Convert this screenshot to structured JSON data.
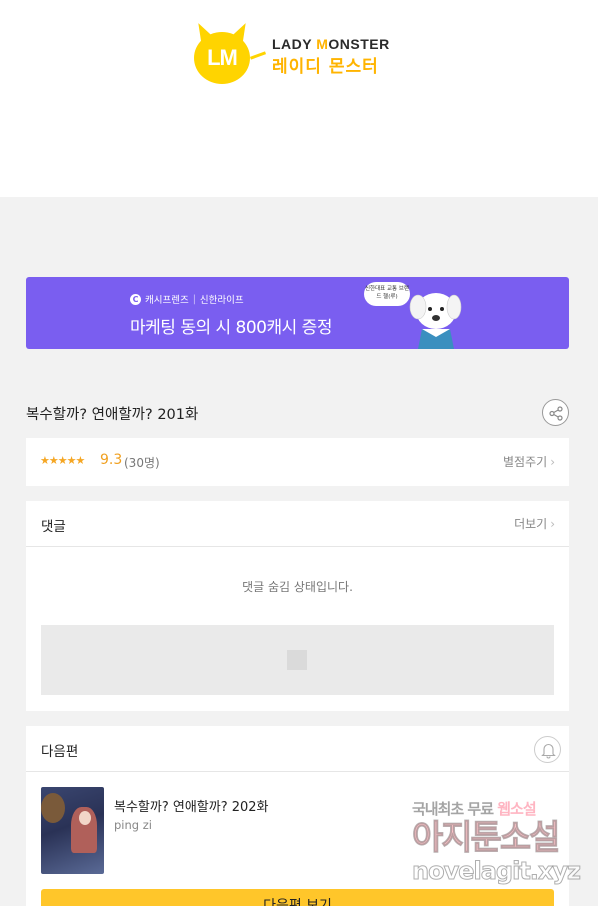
{
  "header": {
    "logo_mark": "LM",
    "logo_en_prefix": "LADY ",
    "logo_en_o": "M",
    "logo_en_rest": "ONSTER",
    "logo_ko": "레이디 몬스터"
  },
  "banner": {
    "c_mark": "C",
    "brand": "캐시프렌즈",
    "sep": "|",
    "partner": "신한라이프",
    "headline": "마케팅 동의 시 800캐시 증정",
    "bubble_text": "신한대표 교통 브랜드 헬(루)"
  },
  "episode": {
    "title": "복수할까? 연애할까? 201화"
  },
  "rating": {
    "stars": "★★★★★",
    "score": "9.3",
    "count": "(30명)",
    "rate_label": "별점주기"
  },
  "comments": {
    "title": "댓글",
    "more_label": "더보기",
    "hidden_message": "댓글 숨김 상태입니다."
  },
  "next": {
    "title": "다음편",
    "episode_title": "복수할까? 연애할까? 202화",
    "author": "ping zi",
    "button_label": "다음편 보기"
  },
  "watermark": {
    "line1_prefix": "국내최초 무료 ",
    "line1_highlight": "웹소설",
    "line2": "아지툰소설",
    "line3": "novelagit.xyz"
  },
  "colors": {
    "accent_yellow": "#ffc62a",
    "banner_purple": "#7a5ef0",
    "star_orange": "#f5a623"
  }
}
